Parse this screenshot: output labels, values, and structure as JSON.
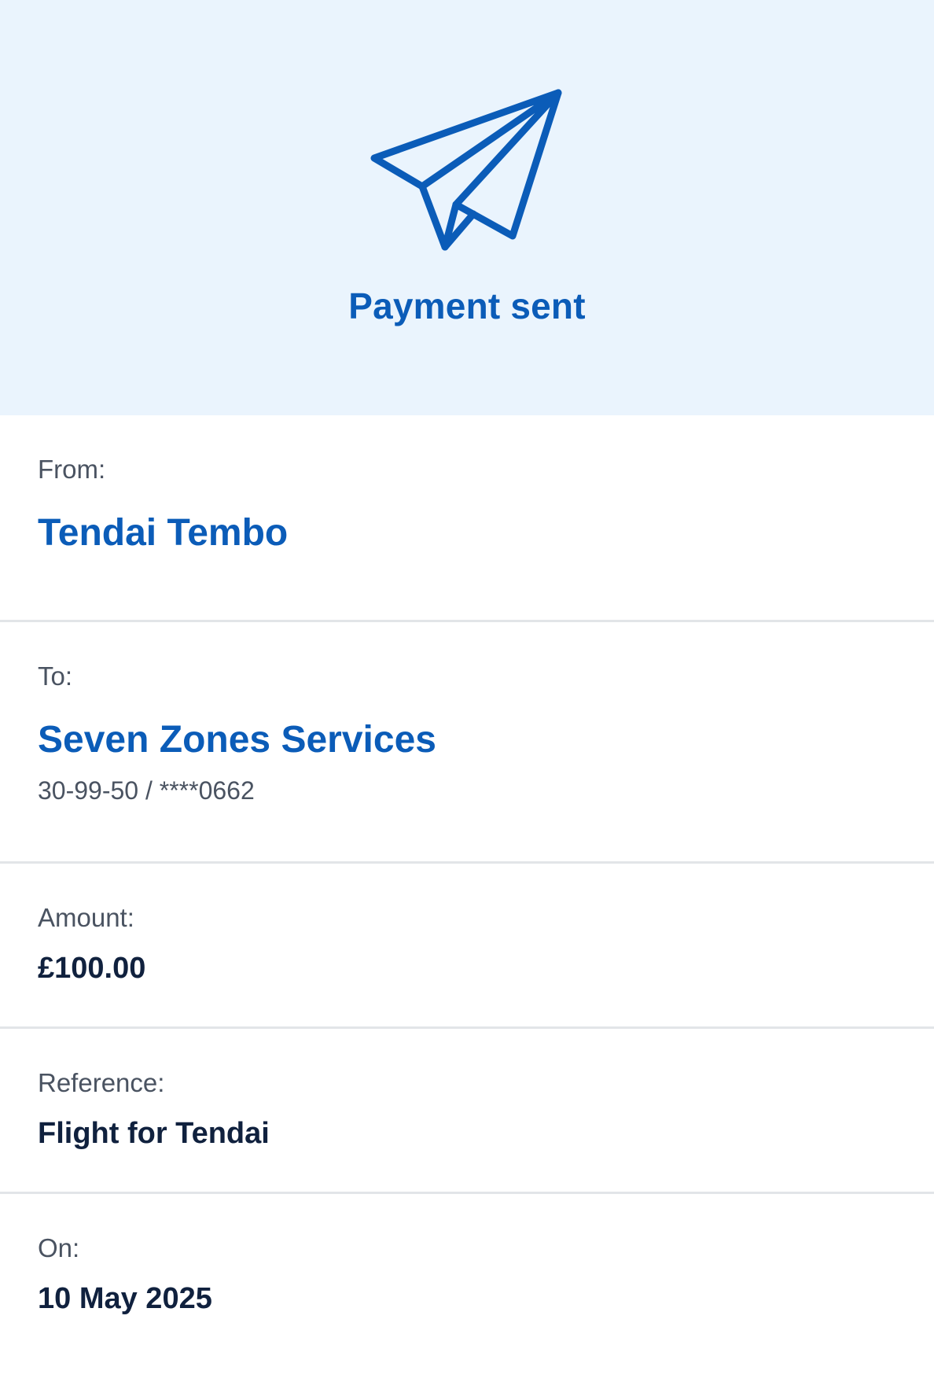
{
  "header": {
    "icon": "paper-plane-icon",
    "title": "Payment sent",
    "background_color": "#eaf4fd",
    "accent_color": "#0b5cb8"
  },
  "details": {
    "from": {
      "label": "From:",
      "name": "Tendai Tembo"
    },
    "to": {
      "label": "To:",
      "name": "Seven Zones Services",
      "account": "30-99-50 / ****0662"
    },
    "amount": {
      "label": "Amount:",
      "value": "£100.00"
    },
    "reference": {
      "label": "Reference:",
      "value": "Flight for Tendai"
    },
    "on": {
      "label": "On:",
      "value": "10 May 2025"
    }
  }
}
